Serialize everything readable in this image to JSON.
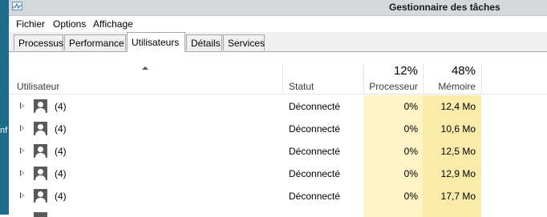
{
  "window": {
    "title": "Gestionnaire des tâches",
    "left_edge_fragment": "nf"
  },
  "menu": [
    "Fichier",
    "Options",
    "Affichage"
  ],
  "tabs": [
    {
      "label": "Processus",
      "active": false
    },
    {
      "label": "Performance",
      "active": false
    },
    {
      "label": "Utilisateurs",
      "active": true
    },
    {
      "label": "Détails",
      "active": false
    },
    {
      "label": "Services",
      "active": false
    }
  ],
  "columns": {
    "user": "Utilisateur",
    "status": "Statut",
    "cpu_label": "Processeur",
    "cpu_total": "12%",
    "mem_label": "Mémoire",
    "mem_total": "48%"
  },
  "rows": [
    {
      "user": "(4)",
      "status": "Déconnecté",
      "cpu": "0%",
      "mem": "12,4 Mo"
    },
    {
      "user": "(4)",
      "status": "Déconnecté",
      "cpu": "0%",
      "mem": "10,6 Mo"
    },
    {
      "user": "(4)",
      "status": "Déconnecté",
      "cpu": "0%",
      "mem": "12,5 Mo"
    },
    {
      "user": "(4)",
      "status": "Déconnecté",
      "cpu": "0%",
      "mem": "12,9 Mo"
    },
    {
      "user": "(4)",
      "status": "Déconnecté",
      "cpu": "0%",
      "mem": "17,7 Mo"
    }
  ],
  "colors": {
    "cpu_heat": "#fdf3c4",
    "mem_heat": "#fbebaa",
    "header_label": "#3c3c3c"
  }
}
